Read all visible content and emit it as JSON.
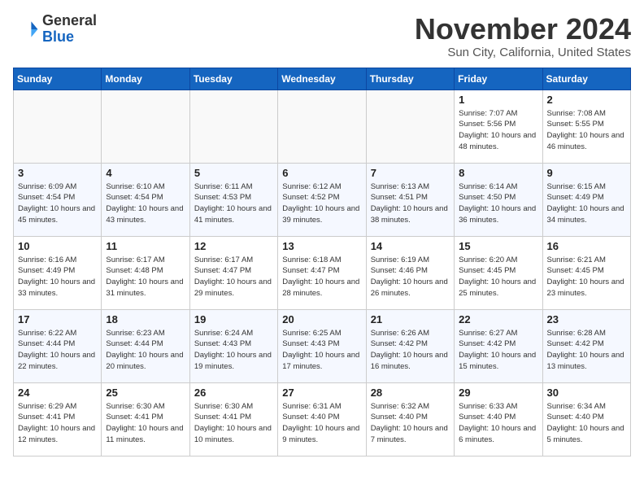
{
  "header": {
    "logo_line1": "General",
    "logo_line2": "Blue",
    "month": "November 2024",
    "location": "Sun City, California, United States"
  },
  "weekdays": [
    "Sunday",
    "Monday",
    "Tuesday",
    "Wednesday",
    "Thursday",
    "Friday",
    "Saturday"
  ],
  "weeks": [
    [
      {
        "day": "",
        "empty": true
      },
      {
        "day": "",
        "empty": true
      },
      {
        "day": "",
        "empty": true
      },
      {
        "day": "",
        "empty": true
      },
      {
        "day": "",
        "empty": true
      },
      {
        "day": "1",
        "sunrise": "7:07 AM",
        "sunset": "5:56 PM",
        "daylight": "10 hours and 48 minutes."
      },
      {
        "day": "2",
        "sunrise": "7:08 AM",
        "sunset": "5:55 PM",
        "daylight": "10 hours and 46 minutes."
      }
    ],
    [
      {
        "day": "3",
        "sunrise": "6:09 AM",
        "sunset": "4:54 PM",
        "daylight": "10 hours and 45 minutes."
      },
      {
        "day": "4",
        "sunrise": "6:10 AM",
        "sunset": "4:54 PM",
        "daylight": "10 hours and 43 minutes."
      },
      {
        "day": "5",
        "sunrise": "6:11 AM",
        "sunset": "4:53 PM",
        "daylight": "10 hours and 41 minutes."
      },
      {
        "day": "6",
        "sunrise": "6:12 AM",
        "sunset": "4:52 PM",
        "daylight": "10 hours and 39 minutes."
      },
      {
        "day": "7",
        "sunrise": "6:13 AM",
        "sunset": "4:51 PM",
        "daylight": "10 hours and 38 minutes."
      },
      {
        "day": "8",
        "sunrise": "6:14 AM",
        "sunset": "4:50 PM",
        "daylight": "10 hours and 36 minutes."
      },
      {
        "day": "9",
        "sunrise": "6:15 AM",
        "sunset": "4:49 PM",
        "daylight": "10 hours and 34 minutes."
      }
    ],
    [
      {
        "day": "10",
        "sunrise": "6:16 AM",
        "sunset": "4:49 PM",
        "daylight": "10 hours and 33 minutes."
      },
      {
        "day": "11",
        "sunrise": "6:17 AM",
        "sunset": "4:48 PM",
        "daylight": "10 hours and 31 minutes."
      },
      {
        "day": "12",
        "sunrise": "6:17 AM",
        "sunset": "4:47 PM",
        "daylight": "10 hours and 29 minutes."
      },
      {
        "day": "13",
        "sunrise": "6:18 AM",
        "sunset": "4:47 PM",
        "daylight": "10 hours and 28 minutes."
      },
      {
        "day": "14",
        "sunrise": "6:19 AM",
        "sunset": "4:46 PM",
        "daylight": "10 hours and 26 minutes."
      },
      {
        "day": "15",
        "sunrise": "6:20 AM",
        "sunset": "4:45 PM",
        "daylight": "10 hours and 25 minutes."
      },
      {
        "day": "16",
        "sunrise": "6:21 AM",
        "sunset": "4:45 PM",
        "daylight": "10 hours and 23 minutes."
      }
    ],
    [
      {
        "day": "17",
        "sunrise": "6:22 AM",
        "sunset": "4:44 PM",
        "daylight": "10 hours and 22 minutes."
      },
      {
        "day": "18",
        "sunrise": "6:23 AM",
        "sunset": "4:44 PM",
        "daylight": "10 hours and 20 minutes."
      },
      {
        "day": "19",
        "sunrise": "6:24 AM",
        "sunset": "4:43 PM",
        "daylight": "10 hours and 19 minutes."
      },
      {
        "day": "20",
        "sunrise": "6:25 AM",
        "sunset": "4:43 PM",
        "daylight": "10 hours and 17 minutes."
      },
      {
        "day": "21",
        "sunrise": "6:26 AM",
        "sunset": "4:42 PM",
        "daylight": "10 hours and 16 minutes."
      },
      {
        "day": "22",
        "sunrise": "6:27 AM",
        "sunset": "4:42 PM",
        "daylight": "10 hours and 15 minutes."
      },
      {
        "day": "23",
        "sunrise": "6:28 AM",
        "sunset": "4:42 PM",
        "daylight": "10 hours and 13 minutes."
      }
    ],
    [
      {
        "day": "24",
        "sunrise": "6:29 AM",
        "sunset": "4:41 PM",
        "daylight": "10 hours and 12 minutes."
      },
      {
        "day": "25",
        "sunrise": "6:30 AM",
        "sunset": "4:41 PM",
        "daylight": "10 hours and 11 minutes."
      },
      {
        "day": "26",
        "sunrise": "6:30 AM",
        "sunset": "4:41 PM",
        "daylight": "10 hours and 10 minutes."
      },
      {
        "day": "27",
        "sunrise": "6:31 AM",
        "sunset": "4:40 PM",
        "daylight": "10 hours and 9 minutes."
      },
      {
        "day": "28",
        "sunrise": "6:32 AM",
        "sunset": "4:40 PM",
        "daylight": "10 hours and 7 minutes."
      },
      {
        "day": "29",
        "sunrise": "6:33 AM",
        "sunset": "4:40 PM",
        "daylight": "10 hours and 6 minutes."
      },
      {
        "day": "30",
        "sunrise": "6:34 AM",
        "sunset": "4:40 PM",
        "daylight": "10 hours and 5 minutes."
      }
    ]
  ]
}
